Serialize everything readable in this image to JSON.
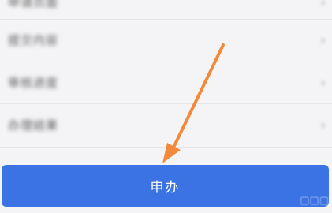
{
  "list": {
    "items": [
      {
        "label": "申请页面",
        "chevron": "›"
      },
      {
        "label": "提交内容",
        "chevron": "›"
      },
      {
        "label": "审核进度",
        "chevron": "›"
      },
      {
        "label": "办理结果",
        "chevron": "›"
      }
    ]
  },
  "primary_button": {
    "label": "申办",
    "color": "#3b73e4"
  },
  "annotation": {
    "icon": "arrow-pointing-down-left-icon",
    "color": "#f28a3b"
  }
}
